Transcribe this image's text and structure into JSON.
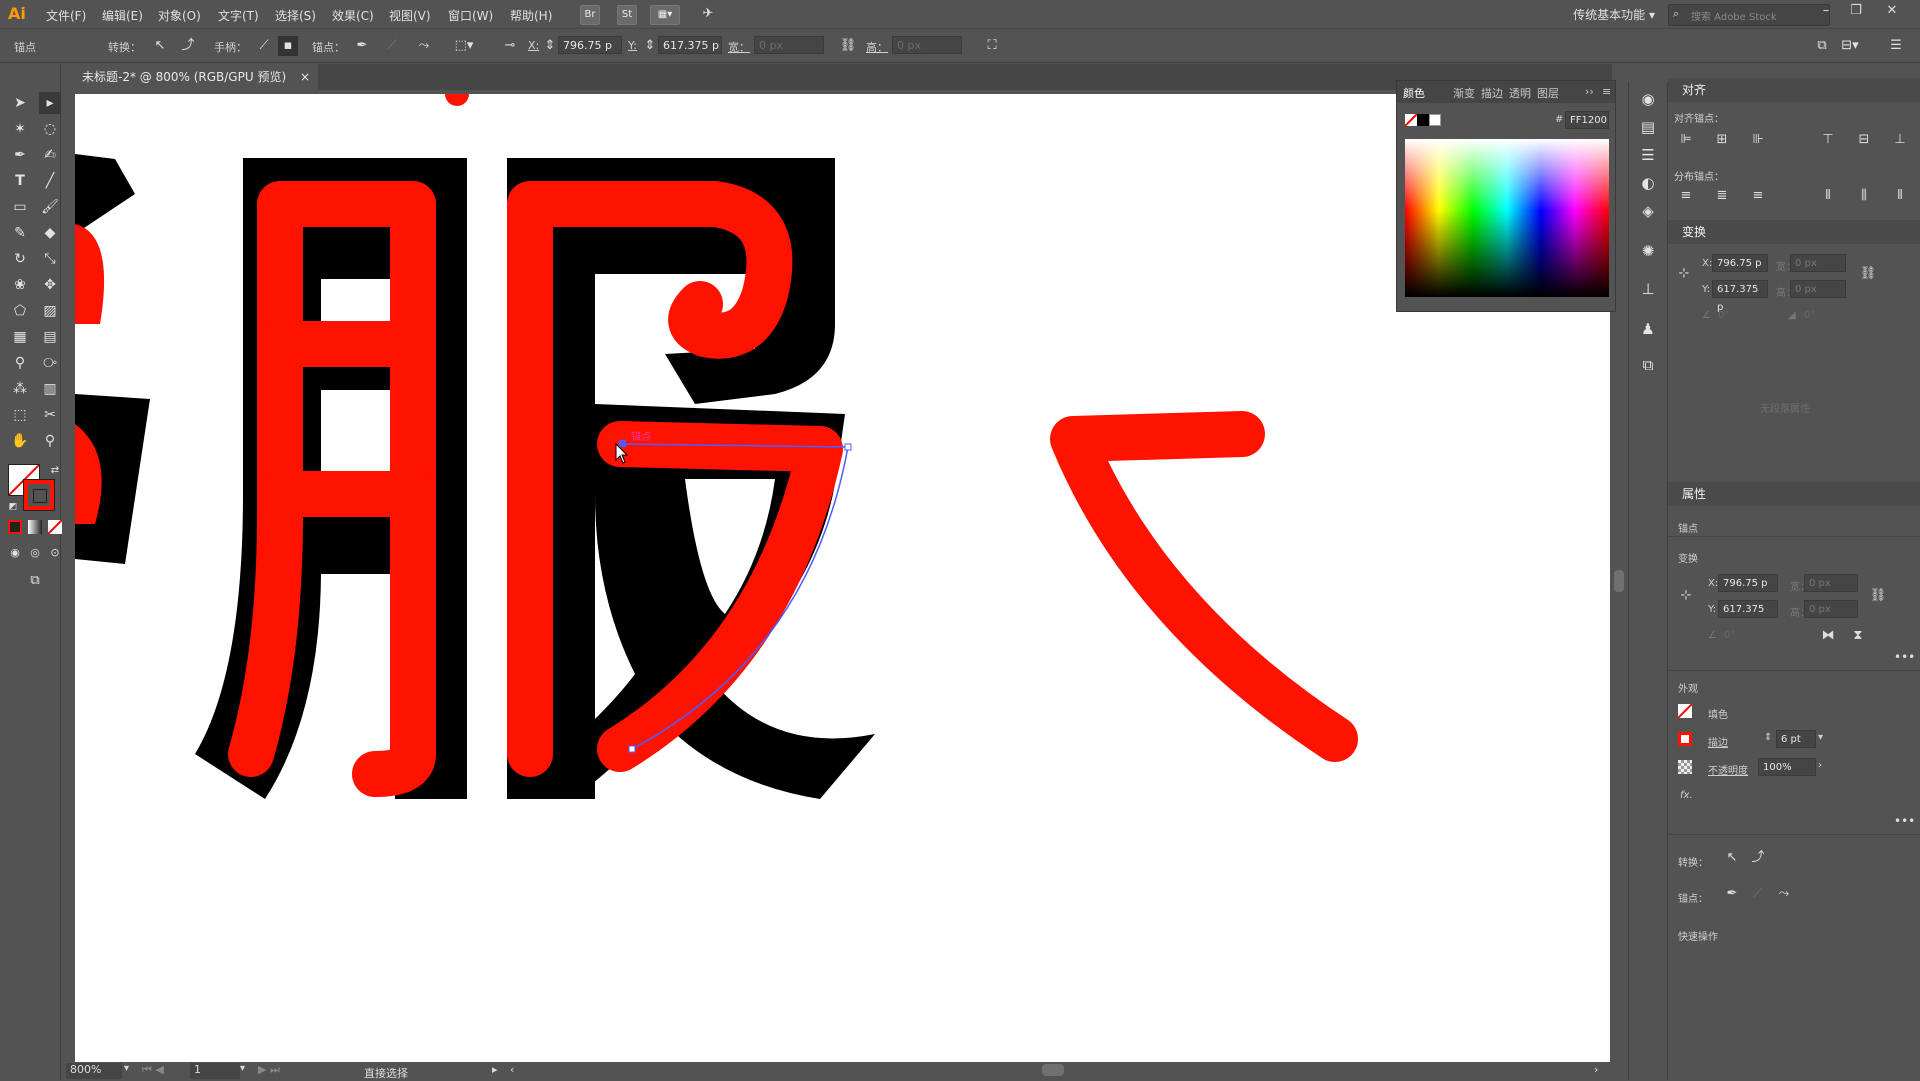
{
  "app": {
    "logo": "Ai"
  },
  "menu": [
    "文件(F)",
    "编辑(E)",
    "对象(O)",
    "文字(T)",
    "选择(S)",
    "效果(C)",
    "视图(V)",
    "窗口(W)",
    "帮助(H)"
  ],
  "menubar_right": {
    "workspace": "传统基本功能",
    "search_placeholder": "搜索 Adobe Stock"
  },
  "control": {
    "anchor_label": "锚点",
    "convert_label": "转换：",
    "handles_label": "手柄：",
    "anchors_label": "锚点：",
    "x_label": "X:",
    "x_value": "796.75 p",
    "y_label": "Y:",
    "y_value": "617.375 p",
    "w_label": "宽：",
    "w_value": "0 px",
    "h_label": "高：",
    "h_value": "0 px"
  },
  "document": {
    "tab_title": "未标题-2* @ 800% (RGB/GPU 预览)",
    "close": "×"
  },
  "canvas": {
    "stroke_color": "#ff1200",
    "shadow_color": "#000000",
    "path_color": "#4d5cff",
    "anchor_label": "锚点"
  },
  "color_panel": {
    "tabs": [
      "颜色",
      "渐变",
      "描边",
      "透明",
      "图层"
    ],
    "hex_prefix": "#",
    "hex": "FF1200"
  },
  "align_panel": {
    "title": "对齐",
    "align_anchor": "对齐锚点：",
    "distribute_anchor": "分布锚点："
  },
  "transform_panel": {
    "title": "变换",
    "x_label": "X:",
    "x": "796.75 p",
    "y_label": "Y:",
    "y": "617.375 p",
    "w_label": "宽：",
    "w": "0 px",
    "h_label": "高：",
    "h": "0 px",
    "angle": "0°",
    "shear": "0°",
    "empty_note": "无段落属性"
  },
  "properties_panel": {
    "title": "属性",
    "selection": "锚点",
    "transform_label": "变换",
    "x_label": "X:",
    "x": "796.75 p",
    "y_label": "Y:",
    "y": "617.375",
    "w_label": "宽：",
    "w": "0 px",
    "h_label": "高：",
    "h": "0 px",
    "angle": "0°",
    "appearance_label": "外观",
    "fill_label": "填色",
    "stroke_label": "描边",
    "stroke_weight": "6 pt",
    "opacity_label": "不透明度",
    "opacity": "100%",
    "fx": "fx.",
    "convert_label": "转换：",
    "anchor_label": "锚点：",
    "quick_actions": "快速操作"
  },
  "status": {
    "zoom": "800%",
    "page": "1",
    "tool": "直接选择"
  }
}
